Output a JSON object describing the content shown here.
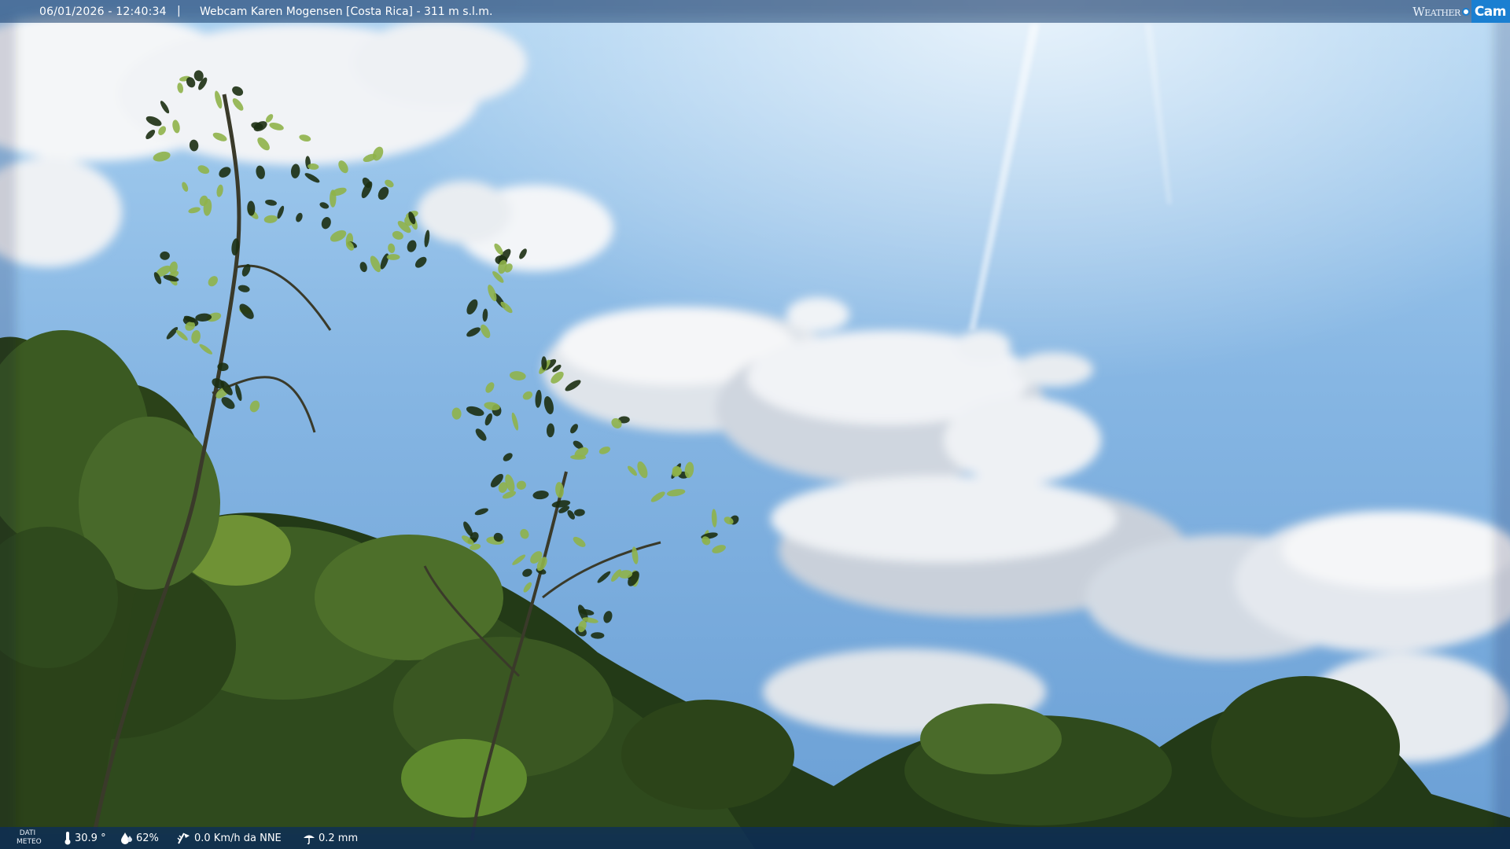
{
  "overlay": {
    "timestamp": "06/01/2026 - 12:40:34",
    "separator": "|",
    "title": "Webcam Karen Mogensen [Costa Rica]  - 311 m s.l.m.",
    "logo_weather": "Weather",
    "logo_cam": "Cam"
  },
  "weather": {
    "label_line1": "DATI",
    "label_line2": "METEO",
    "temperature": "30.9 °",
    "humidity": "62%",
    "wind": "0.0 Km/h da NNE",
    "rain": "0.2 mm"
  },
  "colors": {
    "sky_top": "#9cc8ee",
    "sky_bottom": "#6fa3d8",
    "foliage_dark": "#1c2f12",
    "foliage_light": "#8fb24a",
    "bar_accent": "#1a7fd1"
  }
}
